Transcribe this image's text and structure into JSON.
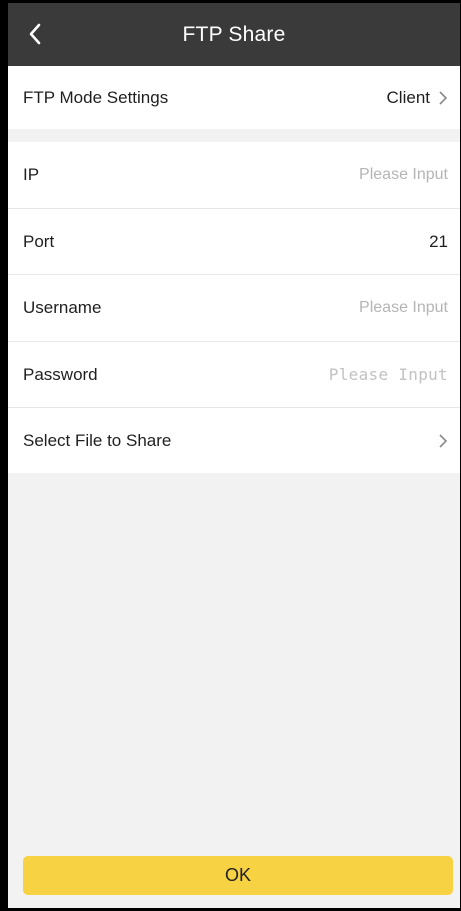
{
  "header": {
    "title": "FTP Share"
  },
  "mode_row": {
    "label": "FTP Mode Settings",
    "value": "Client"
  },
  "form": {
    "ip": {
      "label": "IP",
      "placeholder": "Please Input"
    },
    "port": {
      "label": "Port",
      "value": "21"
    },
    "username": {
      "label": "Username",
      "placeholder": "Please Input"
    },
    "password": {
      "label": "Password",
      "placeholder": "Please Input"
    }
  },
  "select_file_row": {
    "label": "Select File to Share"
  },
  "footer": {
    "ok_label": "OK"
  },
  "colors": {
    "header_bg": "#3a3a3a",
    "ok_button": "#f7d243",
    "page_bg": "#f2f2f2"
  },
  "icons": [
    "back-arrow-icon",
    "chevron-right-icon"
  ]
}
